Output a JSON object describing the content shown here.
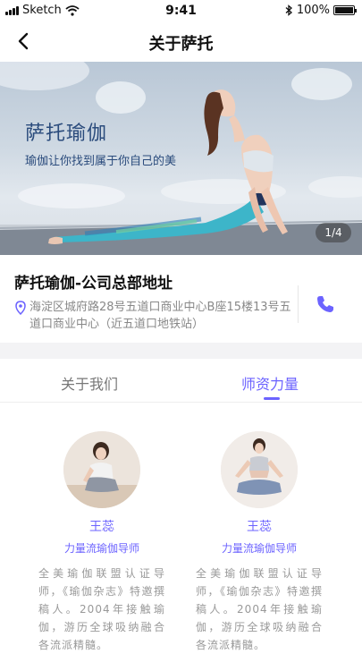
{
  "status_bar": {
    "carrier": "Sketch",
    "time": "9:41",
    "battery": "100%"
  },
  "nav": {
    "title": "关于萨托"
  },
  "banner": {
    "title": "萨托瑜伽",
    "subtitle": "瑜伽让你找到属于你自己的美",
    "page_indicator": "1/4"
  },
  "company": {
    "name": "萨托瑜伽-公司总部地址",
    "address": "海淀区城府路28号五道口商业中心B座15楼13号五道口商业中心（近五道口地铁站）"
  },
  "tabs": [
    {
      "label": "关于我们",
      "active": false
    },
    {
      "label": "师资力量",
      "active": true
    }
  ],
  "teachers": [
    {
      "name": "王蕊",
      "title": "力量流瑜伽导师",
      "bio": "全美瑜伽联盟认证导师，《瑜伽杂志》特邀撰稿人。2004年接触瑜伽，游历全球吸纳融合各流派精髓。"
    },
    {
      "name": "王蕊",
      "title": "力量流瑜伽导师",
      "bio": "全美瑜伽联盟认证导师，《瑜伽杂志》特邀撰稿人。2004年接触瑜伽，游历全球吸纳融合各流派精髓。"
    }
  ],
  "colors": {
    "accent": "#6c63ff",
    "secondary_text": "#999999",
    "banner_text": "#2a4b7c"
  }
}
